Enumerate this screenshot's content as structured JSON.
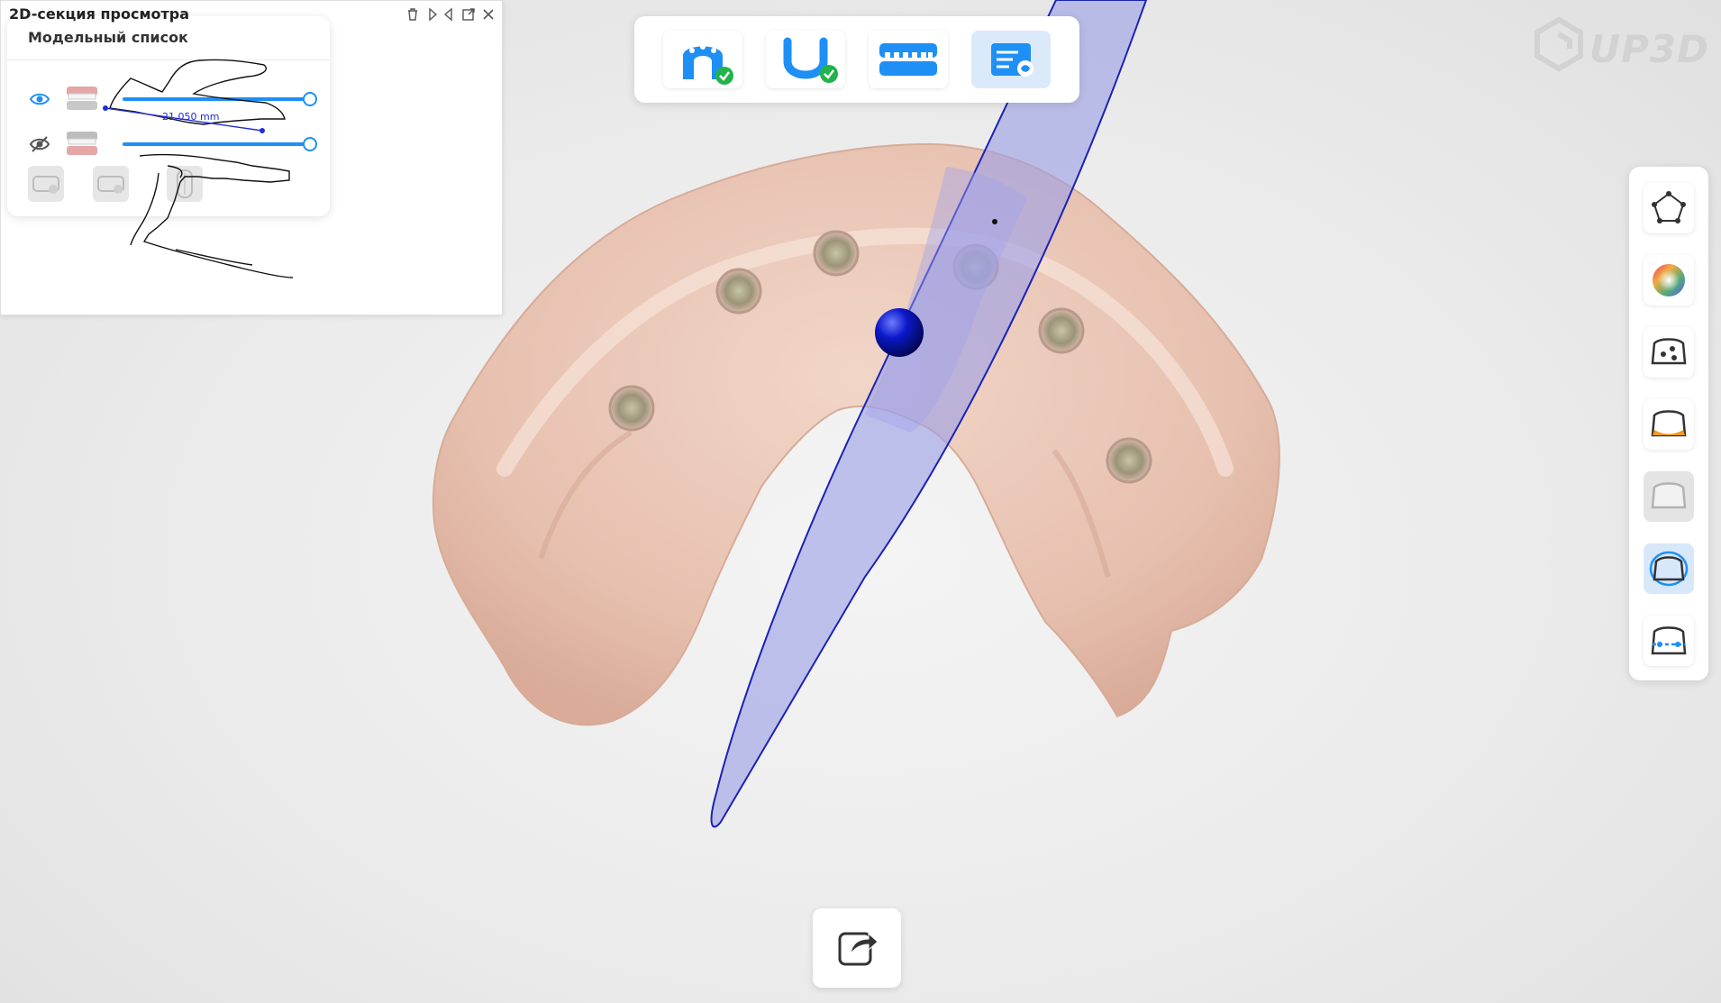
{
  "app": {
    "logo_text": "UP3D"
  },
  "model_list": {
    "title": "Модельный список",
    "rows": [
      {
        "name": "upper-jaw-model",
        "visible": true,
        "opacity": 1.0
      },
      {
        "name": "lower-jaw-model",
        "visible": false,
        "opacity": 1.0
      }
    ],
    "tools": [
      "upper-jaw-tool-icon",
      "lower-jaw-tool-icon",
      "occlusion-tool-icon"
    ]
  },
  "top_toolbar": {
    "steps": [
      {
        "name": "upper-arch-scan",
        "icon": "upper-arch-icon",
        "done": true,
        "active": false
      },
      {
        "name": "lower-arch-scan",
        "icon": "lower-arch-icon",
        "done": true,
        "active": false
      },
      {
        "name": "bite-scan",
        "icon": "bite-icon",
        "done": false,
        "active": false
      },
      {
        "name": "report",
        "icon": "report-icon",
        "done": false,
        "active": true
      }
    ]
  },
  "right_toolbar": {
    "tools": [
      {
        "name": "polygon-select-tool",
        "icon": "polygon-icon",
        "state": "normal"
      },
      {
        "name": "color-tool",
        "icon": "color-wheel-icon",
        "state": "normal"
      },
      {
        "name": "implant-view-tool",
        "icon": "tooth-implant-icon",
        "state": "normal"
      },
      {
        "name": "margin-tool",
        "icon": "tooth-margin-icon",
        "state": "normal"
      },
      {
        "name": "mesh-tool",
        "icon": "tooth-outline-icon",
        "state": "disabled"
      },
      {
        "name": "section-tool",
        "icon": "tooth-section-icon",
        "state": "active"
      },
      {
        "name": "measure-tool",
        "icon": "tooth-measure-icon",
        "state": "normal"
      }
    ]
  },
  "section_panel": {
    "title": "2D-секция просмотра",
    "measurement": "21,050 mm",
    "controls": [
      "delete-icon",
      "flip-left-icon",
      "flip-right-icon",
      "detach-icon",
      "close-icon"
    ]
  },
  "colors": {
    "accent": "#1e8ff5",
    "plane": "#9d9fe6",
    "plane_edge": "#1a22b8",
    "model": "#e8c3b3",
    "sphere": "#0b18c9",
    "measure": "#1f2fd1"
  }
}
